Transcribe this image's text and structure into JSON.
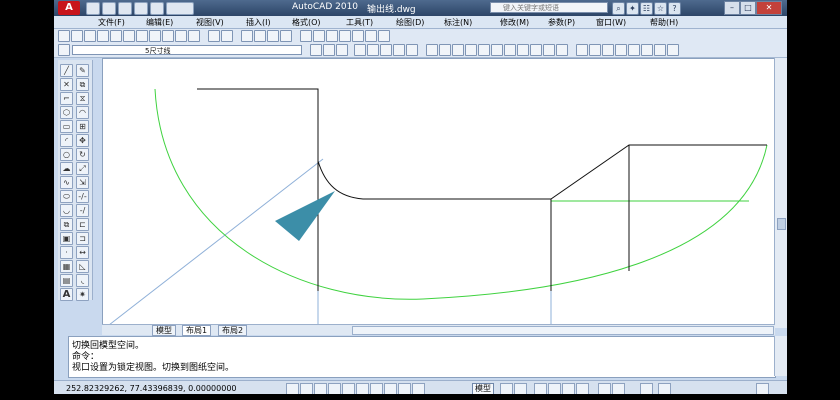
{
  "window": {
    "app_title": "AutoCAD 2010",
    "file_name": "输出线.dwg",
    "search_placeholder": "键入关键字或短语"
  },
  "menu": [
    {
      "label": "文件(F)"
    },
    {
      "label": "编辑(E)"
    },
    {
      "label": "视图(V)"
    },
    {
      "label": "插入(I)"
    },
    {
      "label": "格式(O)"
    },
    {
      "label": "工具(T)"
    },
    {
      "label": "绘图(D)"
    },
    {
      "label": "标注(N)"
    },
    {
      "label": "修改(M)"
    },
    {
      "label": "参数(P)"
    },
    {
      "label": "窗口(W)"
    },
    {
      "label": "帮助(H)"
    }
  ],
  "properties": {
    "layer_value": "5尺寸线"
  },
  "layout_tabs": [
    {
      "label": "模型",
      "active": false
    },
    {
      "label": "布局1",
      "active": true
    },
    {
      "label": "布局2",
      "active": false
    }
  ],
  "command_history": [
    "切换回模型空间。",
    "命令：",
    "视口设置为锁定视图。切换到图纸空间。"
  ],
  "status": {
    "coordinates": "252.82329262, 77.43396839, 0.00000000",
    "model_label": "模型"
  },
  "colors": {
    "green_curve": "#3fd23f",
    "black_profile": "#111111",
    "blue_line": "#8fb0d8",
    "arrow": "#3c8ea8"
  }
}
